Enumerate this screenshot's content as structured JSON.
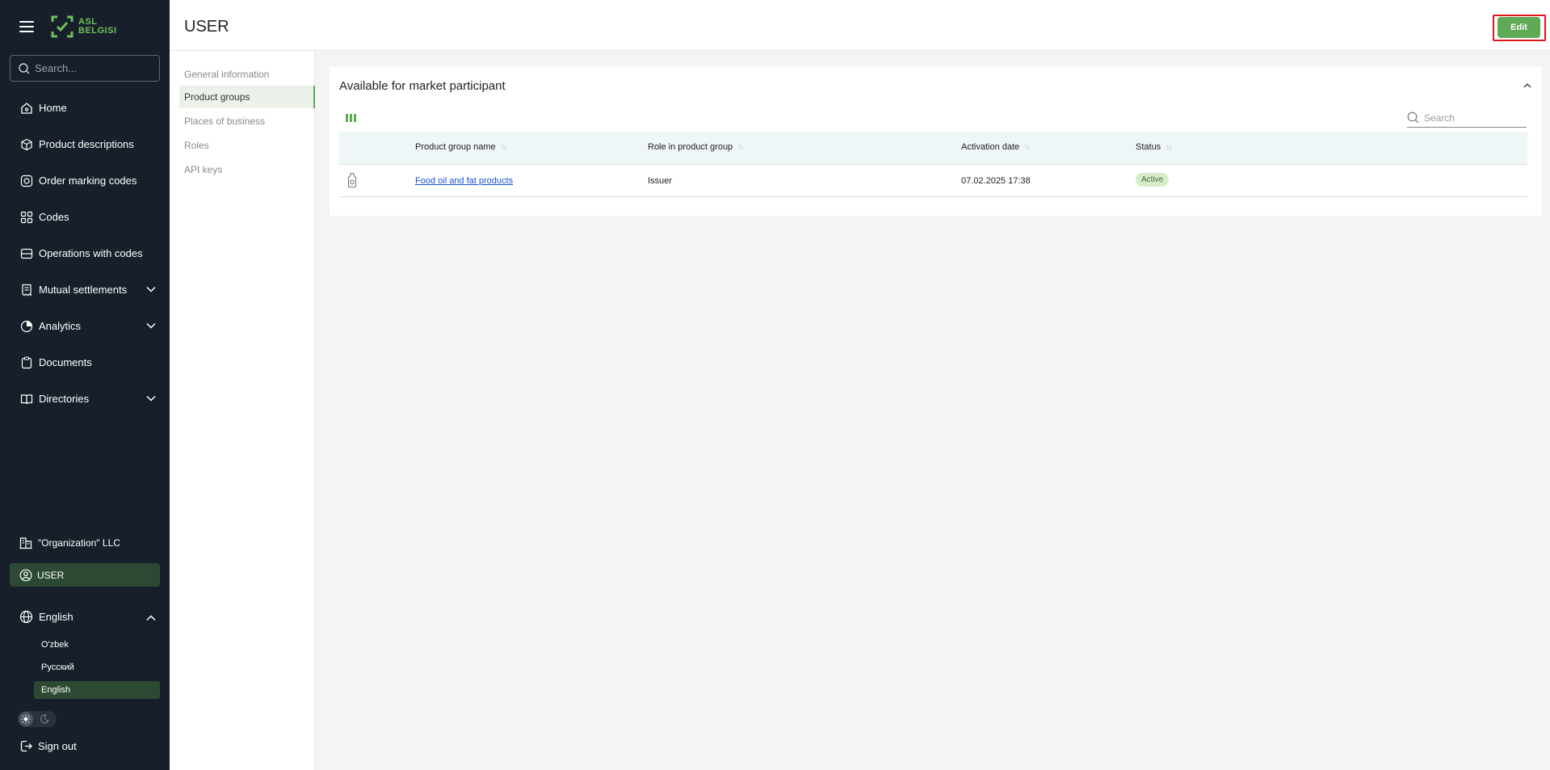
{
  "app": {
    "logo_text_line1": "ASL",
    "logo_text_line2": "BELGISI"
  },
  "sidebar": {
    "search_placeholder": "Search...",
    "items": [
      {
        "label": "Home",
        "icon": "home-icon"
      },
      {
        "label": "Product descriptions",
        "icon": "box-icon"
      },
      {
        "label": "Order marking codes",
        "icon": "order-codes-icon"
      },
      {
        "label": "Codes",
        "icon": "codes-icon"
      },
      {
        "label": "Operations with codes",
        "icon": "operations-icon"
      },
      {
        "label": "Mutual settlements",
        "icon": "receipt-icon",
        "expandable": true
      },
      {
        "label": "Analytics",
        "icon": "analytics-icon",
        "expandable": true
      },
      {
        "label": "Documents",
        "icon": "document-icon"
      },
      {
        "label": "Directories",
        "icon": "book-icon",
        "expandable": true
      }
    ],
    "organization": "\"Organization\" LLC",
    "user": "USER",
    "language": {
      "current": "English",
      "options": [
        "O'zbek",
        "Русский",
        "English"
      ],
      "selected": "English"
    },
    "sign_out": "Sign out"
  },
  "header": {
    "title": "USER",
    "edit_label": "Edit"
  },
  "subnav": {
    "items": [
      "General information",
      "Product groups",
      "Places of business",
      "Roles",
      "API keys"
    ],
    "active": "Product groups"
  },
  "card": {
    "title": "Available for market participant",
    "search_placeholder": "Search",
    "columns": [
      "Product group name",
      "Role in product group",
      "Activation date",
      "Status"
    ],
    "rows": [
      {
        "product_group": "Food oil and fat products",
        "role": "Issuer",
        "activation_date": "07.02.2025 17:38",
        "status": "Active"
      }
    ]
  },
  "colors": {
    "sidebar_bg": "#17202a",
    "accent": "#5eaa55",
    "highlight_frame": "#e3141b"
  }
}
